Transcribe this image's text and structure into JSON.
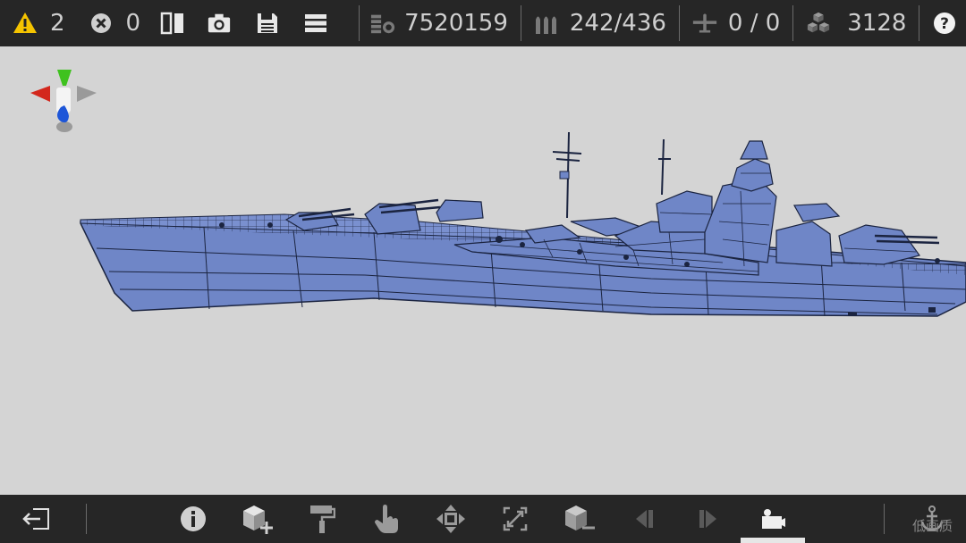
{
  "topbar": {
    "warnings_count": "2",
    "errors_count": "0",
    "cost": "7520159",
    "ammo": "242/436",
    "aircraft": "0 / 0",
    "parts": "3128",
    "icons": [
      "warning-icon",
      "error-icon",
      "split-view-icon",
      "camera-icon",
      "save-icon",
      "menu-icon",
      "cost-icon",
      "ammo-icon",
      "aircraft-icon",
      "parts-icon",
      "help-icon"
    ]
  },
  "bottombar": {
    "icons": [
      "exit-icon",
      "info-icon",
      "add-part-icon",
      "paint-roller-icon",
      "hand-select-icon",
      "move-icon",
      "scale-icon",
      "remove-part-icon",
      "previous-icon",
      "next-icon",
      "camera-mode-icon",
      "anchor-icon"
    ],
    "active_tool": "camera-mode-icon"
  },
  "colors": {
    "bar_bg": "#262626",
    "viewport_bg": "#d4d4d4",
    "warning_yellow": "#f5c400",
    "ship_blue": "#6f86c7",
    "gizmo_green": "#3fc21f",
    "gizmo_red": "#d3271c",
    "gizmo_blue": "#1e56d8"
  },
  "watermark": "低画质"
}
